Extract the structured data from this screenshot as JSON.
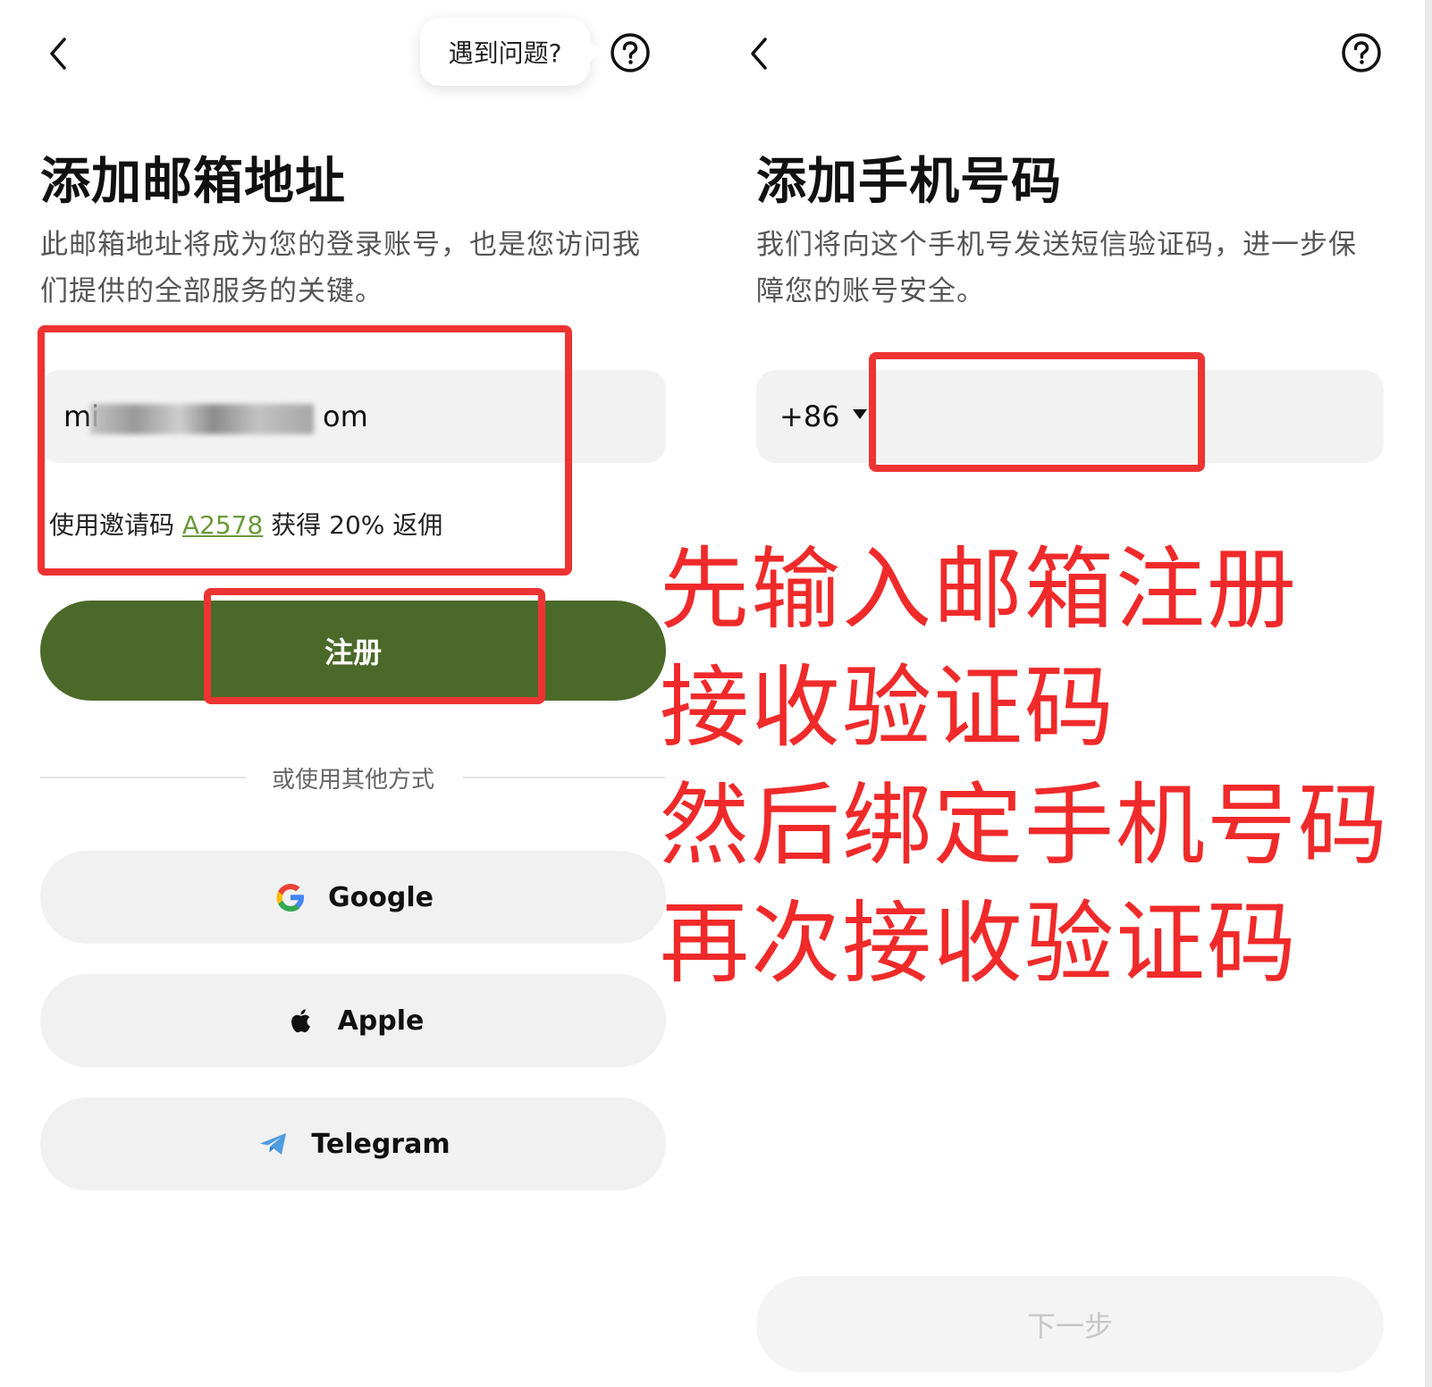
{
  "left": {
    "tooltip": "遇到问题?",
    "title": "添加邮箱地址",
    "description": "此邮箱地址将成为您的登录账号，也是您访问我们提供的全部服务的关键。",
    "email_prefix": "mi",
    "email_suffix": "om",
    "invite_prefix": "使用邀请码",
    "invite_code": "A2578",
    "invite_suffix": "获得 20% 返佣",
    "register_button": "注册",
    "divider": "或使用其他方式",
    "social": [
      {
        "label": "Google",
        "icon": "google-icon"
      },
      {
        "label": "Apple",
        "icon": "apple-icon"
      },
      {
        "label": "Telegram",
        "icon": "telegram-icon"
      }
    ]
  },
  "right": {
    "title": "添加手机号码",
    "description": "我们将向这个手机号发送短信验证码，进一步保障您的账号安全。",
    "country_code": "+86",
    "next_button": "下一步"
  },
  "annotation": {
    "lines": [
      "先输入邮箱注册",
      "接收验证码",
      "然后绑定手机号码",
      "再次接收验证码"
    ]
  },
  "colors": {
    "primary_green": "#4b6a29",
    "annotation_red": "#ee3333",
    "invite_code_green": "#6a9a3a"
  }
}
